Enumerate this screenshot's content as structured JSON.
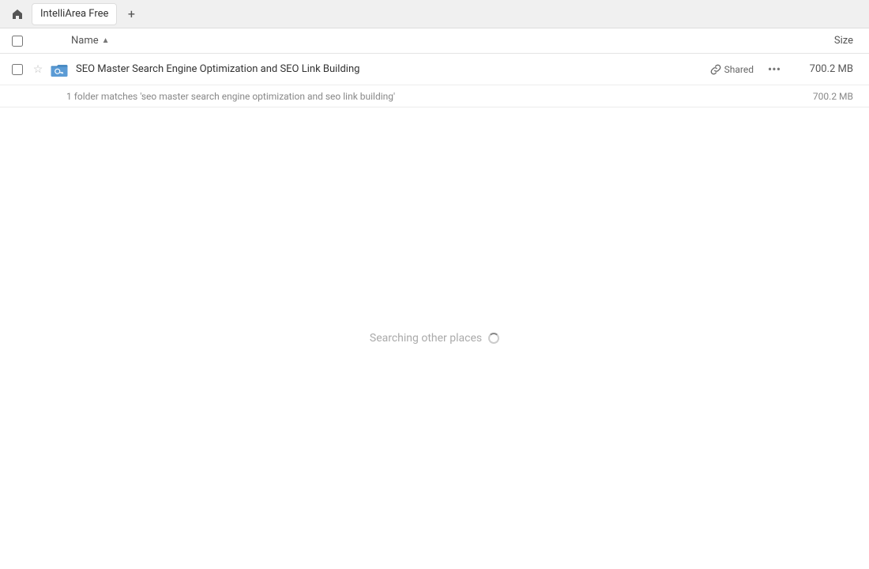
{
  "topbar": {
    "home_icon": "🏠",
    "tab_label": "IntelliArea Free",
    "add_tab_icon": "+"
  },
  "columns": {
    "name_label": "Name",
    "sort_arrow": "▲",
    "size_label": "Size"
  },
  "file_row": {
    "name": "SEO Master Search Engine Optimization and SEO Link Building",
    "shared_label": "Shared",
    "more_icon": "···",
    "size": "700.2 MB",
    "star_icon": "☆",
    "link_icon": "🔗"
  },
  "match_info": {
    "text": "1 folder matches 'seo master search engine optimization and seo link building'",
    "size": "700.2 MB"
  },
  "searching": {
    "text": "Searching other places"
  }
}
